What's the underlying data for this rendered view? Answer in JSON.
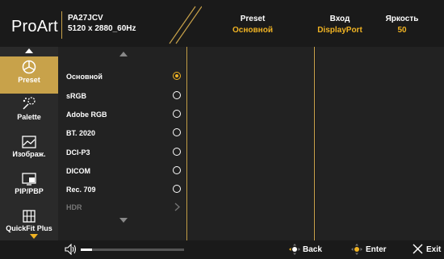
{
  "header": {
    "logo_pro": "Pro",
    "logo_art": "Art",
    "model": "PA27JCV",
    "resolution": "5120 x 2880_60Hz",
    "status": [
      {
        "label": "Preset",
        "value": "Основной"
      },
      {
        "label": "Вход",
        "value": "DisplayPort"
      },
      {
        "label": "Яркость",
        "value": "50"
      }
    ]
  },
  "sidebar": {
    "items": [
      {
        "label": "Preset",
        "icon": "preset-icon",
        "active": true
      },
      {
        "label": "Palette",
        "icon": "palette-icon",
        "active": false
      },
      {
        "label": "Изображ.",
        "icon": "image-icon",
        "active": false
      },
      {
        "label": "PIP/PBP",
        "icon": "pip-icon",
        "active": false
      },
      {
        "label": "QuickFit Plus",
        "icon": "quickfit-icon",
        "active": false
      }
    ]
  },
  "preset_options": [
    {
      "label": "Основной",
      "selected": true
    },
    {
      "label": "sRGB",
      "selected": false
    },
    {
      "label": "Adobe RGB",
      "selected": false
    },
    {
      "label": "BT. 2020",
      "selected": false
    },
    {
      "label": "DCI-P3",
      "selected": false
    },
    {
      "label": "DICOM",
      "selected": false
    },
    {
      "label": "Rec. 709",
      "selected": false
    },
    {
      "label": "HDR",
      "selected": false,
      "disabled": true,
      "submenu": true
    }
  ],
  "footer": {
    "back_label": "Back",
    "enter_label": "Enter",
    "exit_label": "Exit"
  },
  "colors": {
    "accent": "#c8a24a",
    "value": "#f0b323"
  }
}
